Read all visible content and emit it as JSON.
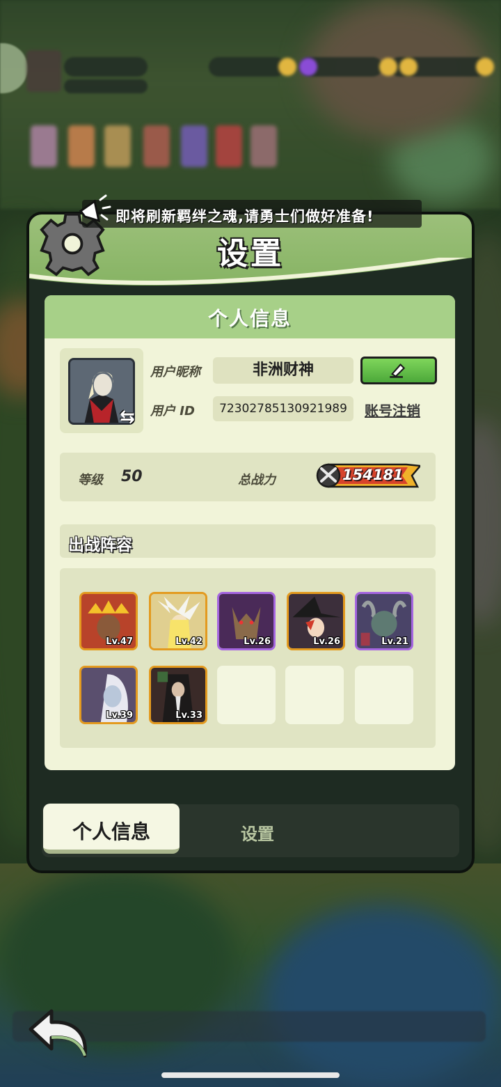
{
  "announcement": "即将刷新羁绊之魂,请勇士们做好准备!",
  "panel": {
    "title": "设置",
    "section_title": "个人信息"
  },
  "profile": {
    "nickname_label": "用户昵称",
    "nickname": "非洲财神",
    "id_label": "用户 ID",
    "user_id": "72302785130921989",
    "cancel_account": "账号注销",
    "level_label": "等级",
    "level": "50",
    "power_label": "总战力",
    "power": "154181"
  },
  "lineup": {
    "title": "出战阵容",
    "heroes": [
      {
        "level": "Lv.47",
        "rarity": "orange",
        "color": "#c4542a"
      },
      {
        "level": "Lv.42",
        "rarity": "orange",
        "color": "#e9d79a"
      },
      {
        "level": "Lv.26",
        "rarity": "purple",
        "color": "#5a3568"
      },
      {
        "level": "Lv.26",
        "rarity": "orange",
        "color": "#3c2f3b"
      },
      {
        "level": "Lv.21",
        "rarity": "purple",
        "color": "#4a4468"
      },
      {
        "level": "Lv.39",
        "rarity": "orange",
        "color": "#5a4f6e"
      },
      {
        "level": "Lv.33",
        "rarity": "orange",
        "color": "#3a2a28"
      }
    ],
    "empty_slots": 3
  },
  "tabs": [
    {
      "label": "个人信息",
      "active": true
    },
    {
      "label": "设置",
      "active": false
    }
  ],
  "colors": {
    "header_green": "#9cc07a",
    "card_bg": "#f1f4d9",
    "edit_button": "#5fbd45",
    "orange_frame": "#e39a1f",
    "purple_frame": "#a566e0"
  },
  "icons": {
    "settings": "gear-icon",
    "edit": "pencil-icon",
    "swap": "swap-arrows-icon",
    "back": "back-arrow-icon",
    "announcement": "megaphone-icon",
    "power": "crossed-swords-icon"
  }
}
